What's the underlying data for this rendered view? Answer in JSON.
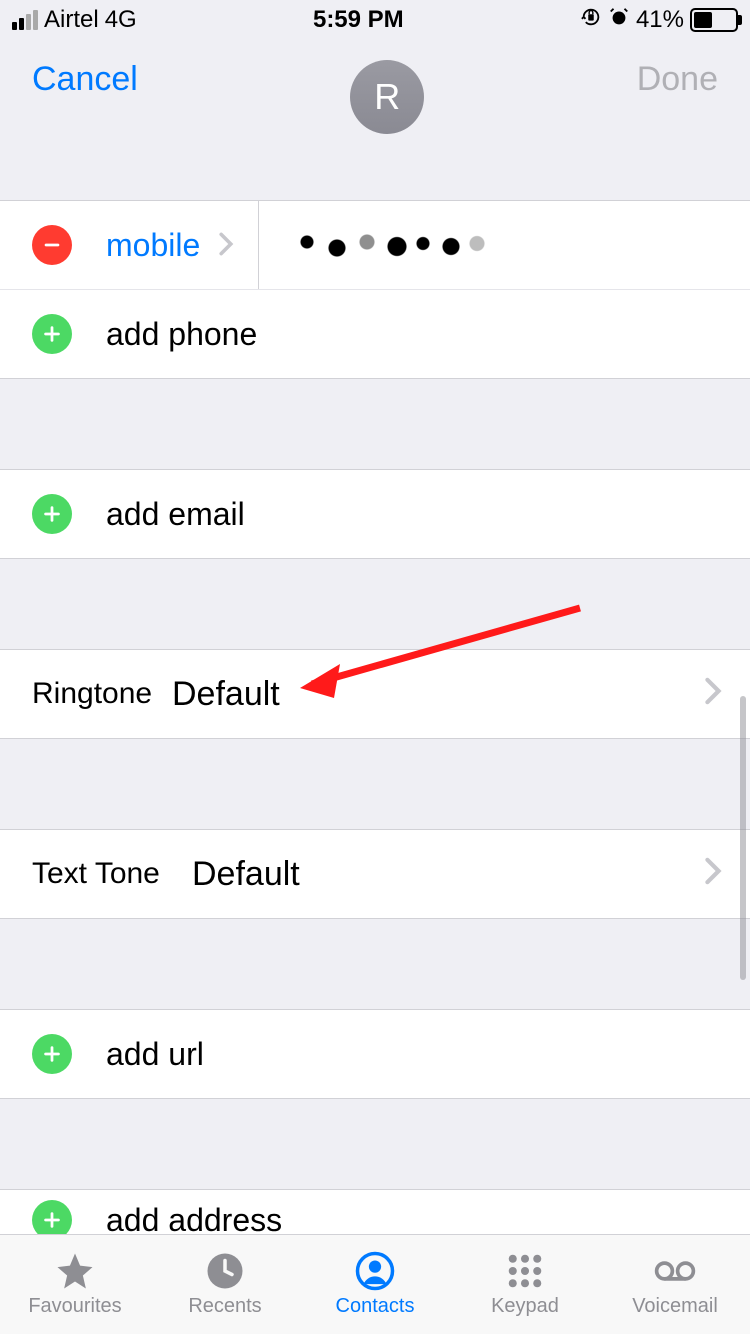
{
  "statusbar": {
    "carrier": "Airtel",
    "network": "4G",
    "time": "5:59 PM",
    "battery_pct": "41%"
  },
  "nav": {
    "cancel": "Cancel",
    "done": "Done",
    "avatar_initial": "R"
  },
  "phone": {
    "type_label": "mobile",
    "add_phone": "add phone"
  },
  "email": {
    "add_email": "add email"
  },
  "ringtone": {
    "label": "Ringtone",
    "value": "Default"
  },
  "texttone": {
    "label": "Text Tone",
    "value": "Default"
  },
  "url": {
    "add_url": "add url"
  },
  "address": {
    "add_address": "add address"
  },
  "tabs": {
    "favourites": "Favourites",
    "recents": "Recents",
    "contacts": "Contacts",
    "keypad": "Keypad",
    "voicemail": "Voicemail"
  }
}
